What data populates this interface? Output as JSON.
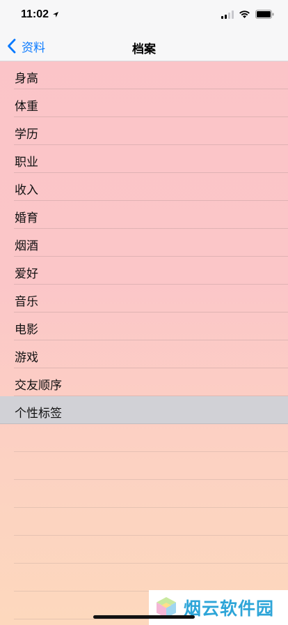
{
  "status_bar": {
    "time": "11:02",
    "icons": [
      "location-arrow-icon",
      "signal-icon",
      "wifi-icon",
      "battery-icon"
    ]
  },
  "nav": {
    "back_label": "资料",
    "title": "档案",
    "accent_color": "#0a7aff"
  },
  "list": {
    "items": [
      {
        "label": "身高"
      },
      {
        "label": "体重"
      },
      {
        "label": "学历"
      },
      {
        "label": "职业"
      },
      {
        "label": "收入"
      },
      {
        "label": "婚育"
      },
      {
        "label": "烟酒"
      },
      {
        "label": "爱好"
      },
      {
        "label": "音乐"
      },
      {
        "label": "电影"
      },
      {
        "label": "游戏"
      },
      {
        "label": "交友顺序"
      },
      {
        "label": "个性标签",
        "selected": true
      }
    ],
    "selected_color": "#d1d1d6"
  },
  "watermark": {
    "text": "烟云软件园"
  }
}
